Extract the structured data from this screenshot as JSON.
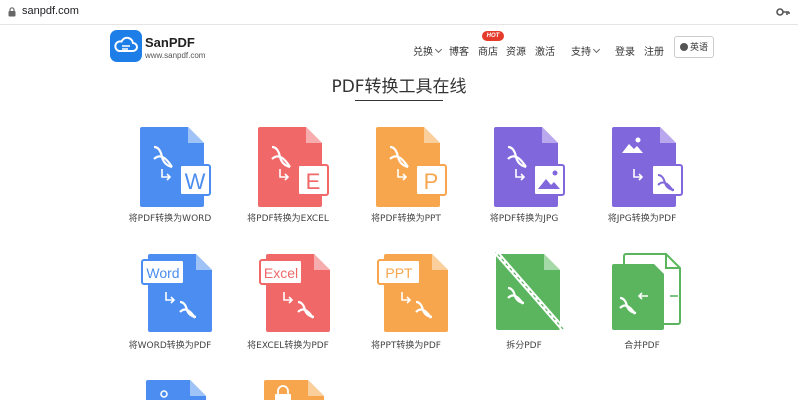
{
  "browser": {
    "url": "sanpdf.com"
  },
  "header": {
    "brand": "SanPDF",
    "brand_url": "www.sanpdf.com",
    "nav": {
      "convert": "兑换",
      "blog": "博客",
      "store": "商店",
      "store_badge": "HOT",
      "resources": "资源",
      "activate": "激活",
      "support": "支持",
      "login": "登录",
      "register": "注册",
      "language": "英语"
    }
  },
  "page_title": "PDF转换工具在线",
  "colors": {
    "brand_blue": "#1e7ee8",
    "word_blue": "#4b8df0",
    "excel_red": "#f06868",
    "ppt_orange": "#f7a64d",
    "jpg_purple": "#8167dc",
    "split_green": "#5bb55f",
    "hot_red": "#e43b2b"
  },
  "tools": [
    {
      "label": "将PDF转换为WORD",
      "icon": "pdf-to-word-icon",
      "letter": "W"
    },
    {
      "label": "将PDF转换为EXCEL",
      "icon": "pdf-to-excel-icon",
      "letter": "E"
    },
    {
      "label": "将PDF转换为PPT",
      "icon": "pdf-to-ppt-icon",
      "letter": "P"
    },
    {
      "label": "将PDF转换为JPG",
      "icon": "pdf-to-jpg-icon"
    },
    {
      "label": "将JPG转换为PDF",
      "icon": "jpg-to-pdf-icon"
    },
    {
      "label": "将WORD转换为PDF",
      "icon": "word-to-pdf-icon",
      "tag": "Word"
    },
    {
      "label": "将EXCEL转换为PDF",
      "icon": "excel-to-pdf-icon",
      "tag": "Excel"
    },
    {
      "label": "将PPT转换为PDF",
      "icon": "ppt-to-pdf-icon",
      "tag": "PPT"
    },
    {
      "label": "拆分PDF",
      "icon": "split-pdf-icon"
    },
    {
      "label": "合并PDF",
      "icon": "merge-pdf-icon"
    }
  ]
}
